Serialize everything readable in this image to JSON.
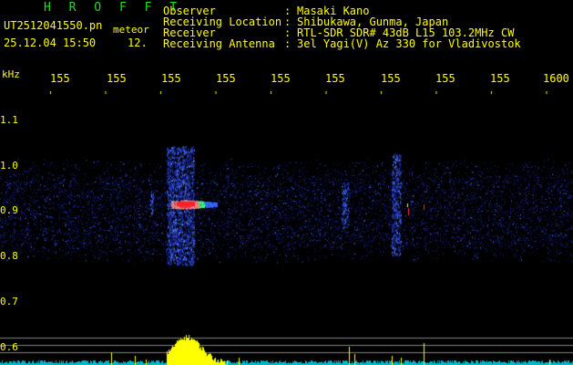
{
  "header": {
    "app_title": "H R O F F T",
    "filename": "UT2512041550.pn",
    "meteor_label": "meteor",
    "timestamp": "25.12.04 15:50",
    "frame_number": "12."
  },
  "info": {
    "separator": ":",
    "rows": [
      {
        "key": "Observer",
        "value": "Masaki Kano"
      },
      {
        "key": "Receiving Location",
        "value": "Shibukawa, Gunma, Japan"
      },
      {
        "key": "Receiver",
        "value": "RTL-SDR SDR# 43dB L15 103.2MHz CW"
      },
      {
        "key": "Receiving Antenna",
        "value": "3el Yagi(V) Az 330 for Vladivostok"
      }
    ]
  },
  "axis": {
    "unit_label": "kHz",
    "time_labels": [
      "155",
      "155",
      "155",
      "155",
      "155",
      "155",
      "155",
      "155",
      "155",
      "1600"
    ],
    "freq_labels": [
      "1.1",
      "1.0",
      "0.9",
      "0.8",
      "0.7",
      "0.6"
    ]
  },
  "colors": {
    "header_text": "#ffff00",
    "title_green": "#22dd22",
    "noise_blue": "#1a2aa8",
    "signal_hot": "#ff3030",
    "baseline_cyan": "#00cccc",
    "peak_yellow": "#ffff00"
  }
}
